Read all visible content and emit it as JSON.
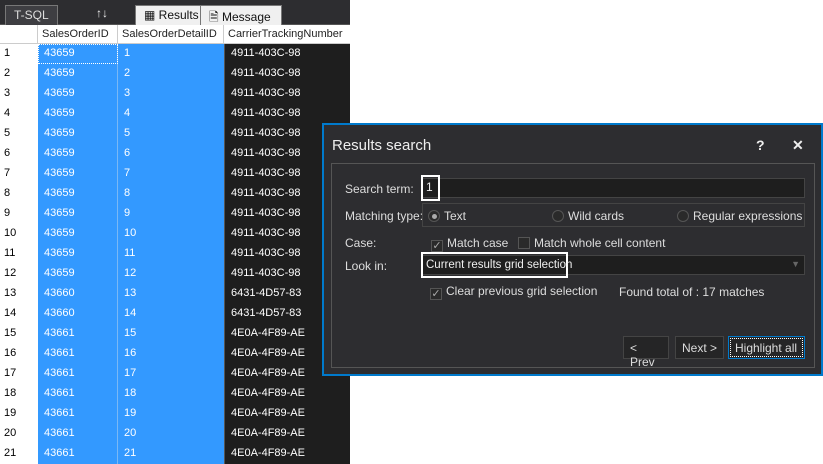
{
  "tabs": {
    "tsql": "T-SQL",
    "sort": "↑↓",
    "results": "Results",
    "message": "Message"
  },
  "grid": {
    "columns": [
      "SalesOrderID",
      "SalesOrderDetailID",
      "CarrierTrackingNumber"
    ],
    "rows": [
      [
        "1",
        "43659",
        "1",
        "4911-403C-98"
      ],
      [
        "2",
        "43659",
        "2",
        "4911-403C-98"
      ],
      [
        "3",
        "43659",
        "3",
        "4911-403C-98"
      ],
      [
        "4",
        "43659",
        "4",
        "4911-403C-98"
      ],
      [
        "5",
        "43659",
        "5",
        "4911-403C-98"
      ],
      [
        "6",
        "43659",
        "6",
        "4911-403C-98"
      ],
      [
        "7",
        "43659",
        "7",
        "4911-403C-98"
      ],
      [
        "8",
        "43659",
        "8",
        "4911-403C-98"
      ],
      [
        "9",
        "43659",
        "9",
        "4911-403C-98"
      ],
      [
        "10",
        "43659",
        "10",
        "4911-403C-98"
      ],
      [
        "11",
        "43659",
        "11",
        "4911-403C-98"
      ],
      [
        "12",
        "43659",
        "12",
        "4911-403C-98"
      ],
      [
        "13",
        "43660",
        "13",
        "6431-4D57-83"
      ],
      [
        "14",
        "43660",
        "14",
        "6431-4D57-83"
      ],
      [
        "15",
        "43661",
        "15",
        "4E0A-4F89-AE"
      ],
      [
        "16",
        "43661",
        "16",
        "4E0A-4F89-AE"
      ],
      [
        "17",
        "43661",
        "17",
        "4E0A-4F89-AE"
      ],
      [
        "18",
        "43661",
        "18",
        "4E0A-4F89-AE"
      ],
      [
        "19",
        "43661",
        "19",
        "4E0A-4F89-AE"
      ],
      [
        "20",
        "43661",
        "20",
        "4E0A-4F89-AE"
      ],
      [
        "21",
        "43661",
        "21",
        "4E0A-4F89-AE"
      ]
    ]
  },
  "dialog": {
    "title": "Results search",
    "help": "?",
    "close": "✕",
    "search_label": "Search term:",
    "search_value": "1",
    "matching_label": "Matching type:",
    "opt_text": "Text",
    "opt_wild": "Wild cards",
    "opt_regex": "Regular expressions",
    "case_label": "Case:",
    "match_case": "Match case",
    "match_whole": "Match whole cell content",
    "lookin_label": "Look in:",
    "lookin_value": "Current results grid selection",
    "clear_prev": "Clear previous grid selection",
    "found": "Found total of : 17 matches",
    "prev": "< Prev",
    "next": "Next >",
    "highlight": "Highlight all"
  },
  "colors": {
    "selection": "#3399ff",
    "accent": "#007acc"
  }
}
